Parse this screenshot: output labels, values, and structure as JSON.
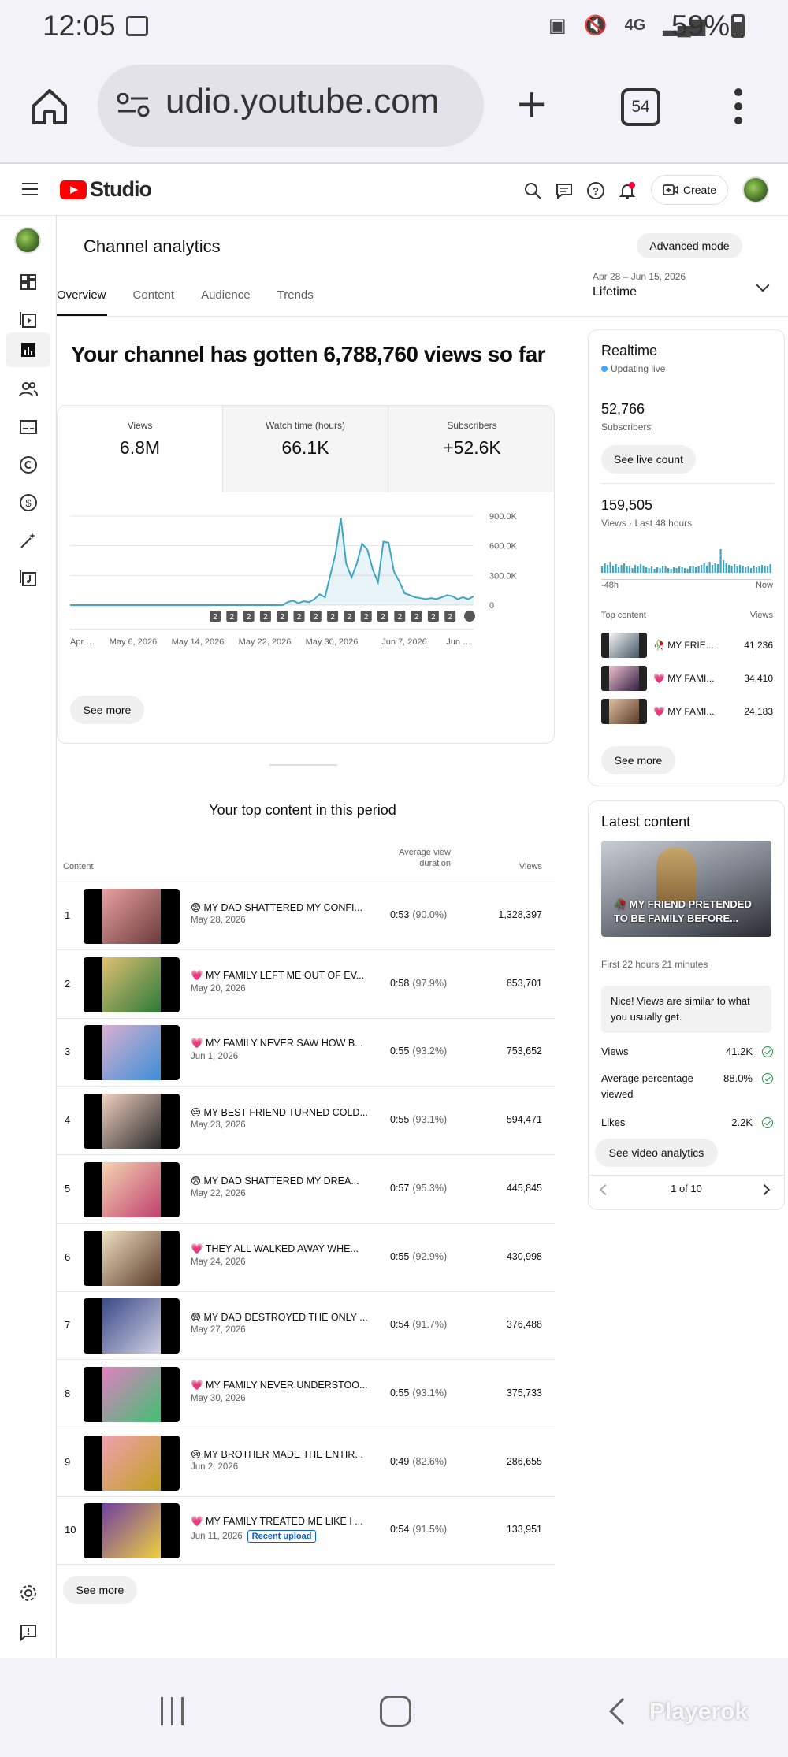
{
  "status": {
    "time": "12:05",
    "battery": "59%",
    "network": "4G"
  },
  "browser": {
    "url": "udio.youtube.com",
    "tab_count": "54"
  },
  "header": {
    "studio_label": "Studio",
    "create_label": "Create"
  },
  "page": {
    "title": "Channel analytics",
    "advanced_mode": "Advanced mode",
    "tabs": [
      "Overview",
      "Content",
      "Audience",
      "Trends"
    ],
    "date_range": "Apr 28 – Jun 15, 2026",
    "period": "Lifetime",
    "headline": "Your channel has gotten 6,788,760 views so far"
  },
  "metrics": [
    {
      "label": "Views",
      "value": "6.8M"
    },
    {
      "label": "Watch time (hours)",
      "value": "66.1K"
    },
    {
      "label": "Subscribers",
      "value": "+52.6K"
    }
  ],
  "chart_data": {
    "type": "line",
    "series": [
      {
        "values": [
          0,
          0,
          0,
          0,
          0,
          0,
          0,
          0,
          0,
          0,
          0,
          0,
          0,
          0,
          0,
          0,
          0,
          0,
          0,
          0,
          0,
          0,
          0,
          0,
          0,
          0,
          0,
          0,
          0,
          0,
          0,
          0,
          0,
          0,
          0,
          0,
          0,
          0,
          0,
          0,
          0,
          30000,
          45000,
          20000,
          40000,
          30000,
          60000,
          110000,
          80000,
          300000,
          520000,
          880000,
          420000,
          280000,
          420000,
          620000,
          560000,
          360000,
          230000,
          640000,
          630000,
          340000,
          240000,
          120000,
          100000,
          80000,
          70000,
          60000,
          70000,
          60000,
          80000,
          100000,
          90000,
          60000,
          80000,
          60000,
          90000
        ]
      }
    ],
    "x_tick_labels": [
      "Apr …",
      "May 6, 2026",
      "May 14, 2026",
      "May 22, 2026",
      "May 30, 2026",
      "Jun 7, 2026",
      "Jun …"
    ],
    "y_tick_labels": [
      "900.0K",
      "600.0K",
      "300.0K",
      "0"
    ],
    "ylim": [
      0,
      900000
    ],
    "markers": [
      "2",
      "2",
      "2",
      "2",
      "2",
      "2",
      "2",
      "2",
      "2",
      "2",
      "2",
      "2",
      "2",
      "2",
      "2"
    ],
    "color": "#3ea6c4"
  },
  "see_more": "See more",
  "top_content": {
    "title": "Your top content in this period",
    "col_content": "Content",
    "col_avg_line1": "Average view",
    "col_avg_line2": "duration",
    "col_views": "Views",
    "rows": [
      {
        "rank": "1",
        "title": "😨 MY DAD SHATTERED MY CONFI...",
        "date": "May 28, 2026",
        "dur": "0:53",
        "pct": "(90.0%)",
        "views": "1,328,397"
      },
      {
        "rank": "2",
        "title": "💗 MY FAMILY LEFT ME OUT OF EV...",
        "date": "May 20, 2026",
        "dur": "0:58",
        "pct": "(97.9%)",
        "views": "853,701"
      },
      {
        "rank": "3",
        "title": "💗 MY FAMILY NEVER SAW HOW B...",
        "date": "Jun 1, 2026",
        "dur": "0:55",
        "pct": "(93.2%)",
        "views": "753,652"
      },
      {
        "rank": "4",
        "title": "😔 MY BEST FRIEND TURNED COLD...",
        "date": "May 23, 2026",
        "dur": "0:55",
        "pct": "(93.1%)",
        "views": "594,471"
      },
      {
        "rank": "5",
        "title": "😨 MY DAD SHATTERED MY DREA...",
        "date": "May 22, 2026",
        "dur": "0:57",
        "pct": "(95.3%)",
        "views": "445,845"
      },
      {
        "rank": "6",
        "title": "💗 THEY ALL WALKED AWAY WHE...",
        "date": "May 24, 2026",
        "dur": "0:55",
        "pct": "(92.9%)",
        "views": "430,998"
      },
      {
        "rank": "7",
        "title": "😨 MY DAD DESTROYED THE ONLY ...",
        "date": "May 27, 2026",
        "dur": "0:54",
        "pct": "(91.7%)",
        "views": "376,488"
      },
      {
        "rank": "8",
        "title": "💗 MY FAMILY NEVER UNDERSTOO...",
        "date": "May 30, 2026",
        "dur": "0:55",
        "pct": "(93.1%)",
        "views": "375,733"
      },
      {
        "rank": "9",
        "title": "😢 MY BROTHER MADE THE ENTIR...",
        "date": "Jun 2, 2026",
        "dur": "0:49",
        "pct": "(82.6%)",
        "views": "286,655"
      },
      {
        "rank": "10",
        "title": "💗 MY FAMILY TREATED ME LIKE I ...",
        "date": "Jun 11, 2026",
        "badge": "Recent upload",
        "dur": "0:54",
        "pct": "(91.5%)",
        "views": "133,951"
      }
    ]
  },
  "realtime": {
    "title": "Realtime",
    "live": "Updating live",
    "subs_value": "52,766",
    "subs_label": "Subscribers",
    "live_count": "See live count",
    "views_value": "159,505",
    "views_label": "Views · Last 48 hours",
    "axis_left": "-48h",
    "axis_right": "Now",
    "top_label": "Top content",
    "views_col": "Views",
    "items": [
      {
        "title": "🥀 MY FRIE...",
        "views": "41,236"
      },
      {
        "title": "💗 MY FAMI...",
        "views": "34,410"
      },
      {
        "title": "💗 MY FAMI...",
        "views": "24,183"
      }
    ]
  },
  "latest": {
    "title": "Latest content",
    "video_title": "🥀 MY FRIEND PRETENDED TO BE FAMILY BEFORE...",
    "first_period": "First 22 hours 21 minutes",
    "note": "Nice! Views are similar to what you usually get.",
    "stats": [
      {
        "label": "Views",
        "value": "41.2K"
      },
      {
        "label": "Average percentage viewed",
        "value": "88.0%"
      },
      {
        "label": "Likes",
        "value": "2.2K"
      }
    ],
    "analytics_btn": "See video analytics",
    "pager": "1 of 10"
  },
  "watermark": "Playerok"
}
